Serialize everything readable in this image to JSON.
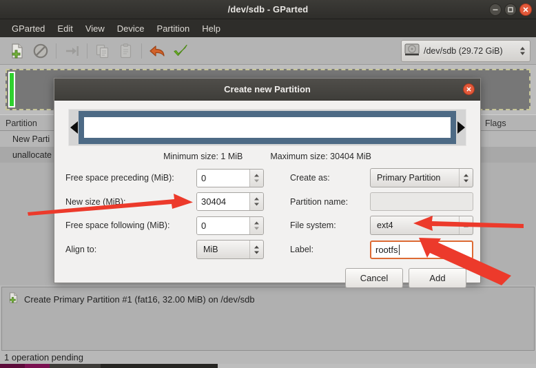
{
  "window": {
    "title": "/dev/sdb - GParted",
    "controls": [
      {
        "name": "minimize",
        "glyph": "minimize-icon"
      },
      {
        "name": "maximize",
        "glyph": "maximize-icon"
      },
      {
        "name": "close",
        "glyph": "close-icon"
      }
    ]
  },
  "menubar": {
    "items": [
      "GParted",
      "Edit",
      "View",
      "Device",
      "Partition",
      "Help"
    ]
  },
  "toolbar": {
    "buttons": [
      {
        "name": "new-partition",
        "icon": "new-document-icon",
        "enabled": true
      },
      {
        "name": "delete-partition",
        "icon": "no-entry-icon",
        "enabled": true
      },
      {
        "name": "resize-move",
        "icon": "resize-arrow-icon",
        "enabled": false
      },
      {
        "name": "copy",
        "icon": "copy-icon",
        "enabled": false
      },
      {
        "name": "paste",
        "icon": "paste-icon",
        "enabled": false
      },
      {
        "name": "undo",
        "icon": "undo-arrow-icon",
        "enabled": true
      },
      {
        "name": "apply",
        "icon": "green-check-icon",
        "enabled": true
      }
    ],
    "device_selector": {
      "icon": "hard-disk-icon",
      "label": "/dev/sdb  (29.72 GiB)"
    }
  },
  "partition_list": {
    "columns": [
      "Partition",
      "Flags"
    ],
    "rows": [
      {
        "partition": "New Parti",
        "flags": ""
      },
      {
        "partition": "unallocate",
        "flags": ""
      }
    ]
  },
  "dialog": {
    "title": "Create new Partition",
    "close_icon": "close-icon",
    "size_widget": {
      "left_arrow_icon": "left-triangle-icon",
      "right_arrow_icon": "right-triangle-icon"
    },
    "minimum_size": "Minimum size: 1 MiB",
    "maximum_size": "Maximum size: 30404 MiB",
    "fields": {
      "free_preceding_label": "Free space preceding (MiB):",
      "free_preceding_value": "0",
      "new_size_label": "New size (MiB):",
      "new_size_value": "30404",
      "free_following_label": "Free space following (MiB):",
      "free_following_value": "0",
      "align_to_label": "Align to:",
      "align_to_value": "MiB",
      "create_as_label": "Create as:",
      "create_as_value": "Primary Partition",
      "partition_name_label": "Partition name:",
      "partition_name_value": "",
      "file_system_label": "File system:",
      "file_system_value": "ext4",
      "label_label": "Label:",
      "label_value": "rootfs"
    },
    "buttons": {
      "cancel": "Cancel",
      "add": "Add"
    }
  },
  "pending_operations": {
    "icon": "new-document-icon",
    "items": [
      "Create Primary Partition #1 (fat16, 32.00 MiB) on /dev/sdb"
    ]
  },
  "statusbar": {
    "text": "1 operation pending"
  },
  "colors": {
    "accent_orange": "#dd6a33",
    "size_bar_blue": "#4d6a85",
    "partition_green": "#2fd12f",
    "annotation_red": "#ec3a2b",
    "titlebar_dark": "#33322f"
  }
}
